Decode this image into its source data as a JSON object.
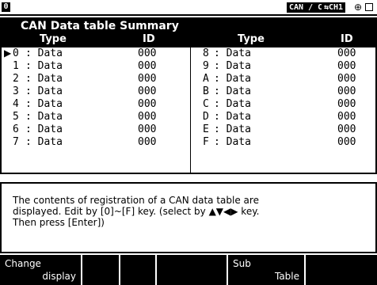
{
  "status": {
    "mode_indicator": "0",
    "channel_label": "CAN / CAN",
    "channel_selector": "⇆CH1",
    "connector_icon": "connector-icon",
    "battery_icon": "battery-icon"
  },
  "panel": {
    "title": "CAN Data table Summary",
    "headers": {
      "type": "Type",
      "id": "ID"
    },
    "left": [
      {
        "hex": "0",
        "type": ": Data",
        "id": "000",
        "selected": true
      },
      {
        "hex": "1",
        "type": ": Data",
        "id": "000"
      },
      {
        "hex": "2",
        "type": ": Data",
        "id": "000"
      },
      {
        "hex": "3",
        "type": ": Data",
        "id": "000"
      },
      {
        "hex": "4",
        "type": ": Data",
        "id": "000"
      },
      {
        "hex": "5",
        "type": ": Data",
        "id": "000"
      },
      {
        "hex": "6",
        "type": ": Data",
        "id": "000"
      },
      {
        "hex": "7",
        "type": ": Data",
        "id": "000"
      }
    ],
    "right": [
      {
        "hex": "8",
        "type": ": Data",
        "id": "000"
      },
      {
        "hex": "9",
        "type": ": Data",
        "id": "000"
      },
      {
        "hex": "A",
        "type": ": Data",
        "id": "000"
      },
      {
        "hex": "B",
        "type": ": Data",
        "id": "000"
      },
      {
        "hex": "C",
        "type": ": Data",
        "id": "000"
      },
      {
        "hex": "D",
        "type": ": Data",
        "id": "000"
      },
      {
        "hex": "E",
        "type": ": Data",
        "id": "000"
      },
      {
        "hex": "F",
        "type": ": Data",
        "id": "000"
      }
    ],
    "cursor_icon": "selection-triangle-icon"
  },
  "message": {
    "line1": "The contents of registration of a CAN data table are",
    "line2": "displayed. Edit by [0]~[F] key. (select by ▲▼◀▶ key.",
    "line3": "Then press [Enter])"
  },
  "fkeys": [
    {
      "line1": "Change",
      "line2": "display"
    },
    {
      "line1": "",
      "line2": ""
    },
    {
      "line1": "",
      "line2": ""
    },
    {
      "line1": "",
      "line2": ""
    },
    {
      "line1": "Sub",
      "line2": "Table"
    },
    {
      "line1": "",
      "line2": ""
    }
  ],
  "colors": {
    "foreground": "#000000",
    "background": "#ffffff"
  }
}
